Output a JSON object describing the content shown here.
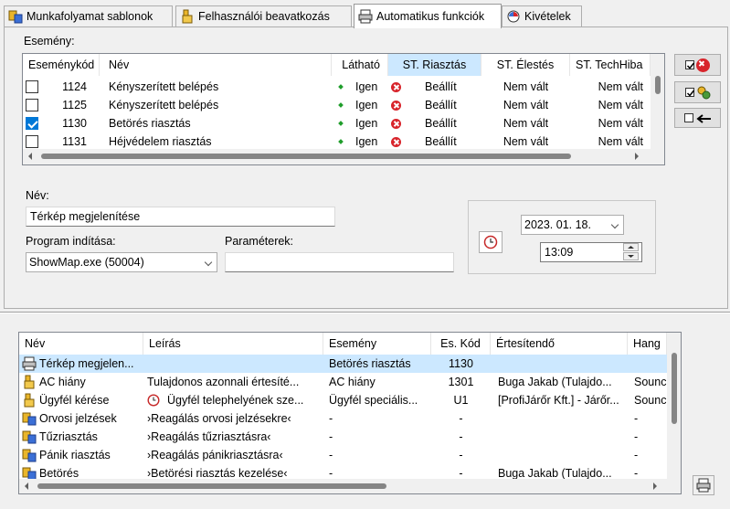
{
  "tabs": [
    {
      "label": "Munkafolyamat sablonok",
      "icon": "workflow-icon"
    },
    {
      "label": "Felhasználói beavatkozás",
      "icon": "user-hand-icon"
    },
    {
      "label": "Automatikus funkciók",
      "icon": "printer-icon",
      "active": true
    },
    {
      "label": "Kivételek",
      "icon": "exception-clock-icon"
    }
  ],
  "event_section": {
    "label": "Esemény:",
    "columns": [
      "Eseménykód",
      "Név",
      "Látható",
      "ST. Riasztás",
      "ST. Élestés",
      "ST. TechHiba"
    ],
    "rows": [
      {
        "checked": false,
        "code": "1124",
        "name": "Kényszerített belépés",
        "visible": "Igen",
        "alarm": "Beállít",
        "arming": "Nem vált",
        "tech": "Nem vált"
      },
      {
        "checked": false,
        "code": "1125",
        "name": "Kényszerített belépés",
        "visible": "Igen",
        "alarm": "Beállít",
        "arming": "Nem vált",
        "tech": "Nem vált"
      },
      {
        "checked": true,
        "code": "1130",
        "name": "Betörés riasztás",
        "visible": "Igen",
        "alarm": "Beállít",
        "arming": "Nem vált",
        "tech": "Nem vált"
      },
      {
        "checked": false,
        "code": "1131",
        "name": "Héjvédelem riasztás",
        "visible": "Igen",
        "alarm": "Beállít",
        "arming": "Nem vált",
        "tech": "Nem vált"
      }
    ]
  },
  "form": {
    "name_label": "Név:",
    "name_value": "Térkép megjelenítése",
    "program_label": "Program indítása:",
    "program_value": "ShowMap.exe (50004)",
    "params_label": "Paraméterek:",
    "params_value": "",
    "date_value": "2023. 01. 18.",
    "time_value": "13:09"
  },
  "functions": {
    "columns": [
      "Név",
      "Leírás",
      "Esemény",
      "Es. Kód",
      "Értesítendő",
      "Hang"
    ],
    "rows": [
      {
        "icon": "printer-icon",
        "name": "Térkép megjelen...",
        "desc": "",
        "desc_icon": "",
        "event": "Betörés riasztás",
        "code": "1130",
        "notify": "",
        "sound": "",
        "selected": true
      },
      {
        "icon": "user-hand-icon",
        "name": "AC hiány",
        "desc": "Tulajdonos azonnali értesíté...",
        "desc_icon": "",
        "event": "AC hiány",
        "code": "1301",
        "notify": "Buga Jakab (Tulajdo...",
        "sound": "Sounc"
      },
      {
        "icon": "user-hand-icon",
        "name": "Ügyfél kérése",
        "desc": "Ügyfél telephelyének sze...",
        "desc_icon": "clock-icon",
        "event": "Ügyfél speciális...",
        "code": "U1",
        "notify": "[ProfiJárőr Kft.] - Járőr...",
        "sound": "Sounc"
      },
      {
        "icon": "workflow-icon",
        "name": "Orvosi jelzések",
        "desc": "›Reagálás orvosi jelzésekre‹",
        "desc_icon": "",
        "event": "-",
        "code": "-",
        "notify": "",
        "sound": "-"
      },
      {
        "icon": "workflow-icon",
        "name": "Tűzriasztás",
        "desc": "›Reagálás tűzriasztásra‹",
        "desc_icon": "",
        "event": "-",
        "code": "-",
        "notify": "",
        "sound": "-"
      },
      {
        "icon": "workflow-icon",
        "name": "Pánik riasztás",
        "desc": "›Reagálás pánikriasztásra‹",
        "desc_icon": "",
        "event": "-",
        "code": "-",
        "notify": "",
        "sound": "-"
      },
      {
        "icon": "workflow-icon",
        "name": "Betörés",
        "desc": "›Betörési riasztás kezelése‹",
        "desc_icon": "",
        "event": "-",
        "code": "-",
        "notify": "Buga Jakab (Tulajdo...",
        "sound": "-"
      }
    ]
  },
  "colors": {
    "accent": "#0078d7",
    "selected_row": "#cce8ff",
    "error_red": "#d8242b",
    "ok_green": "#1f9d2b"
  }
}
